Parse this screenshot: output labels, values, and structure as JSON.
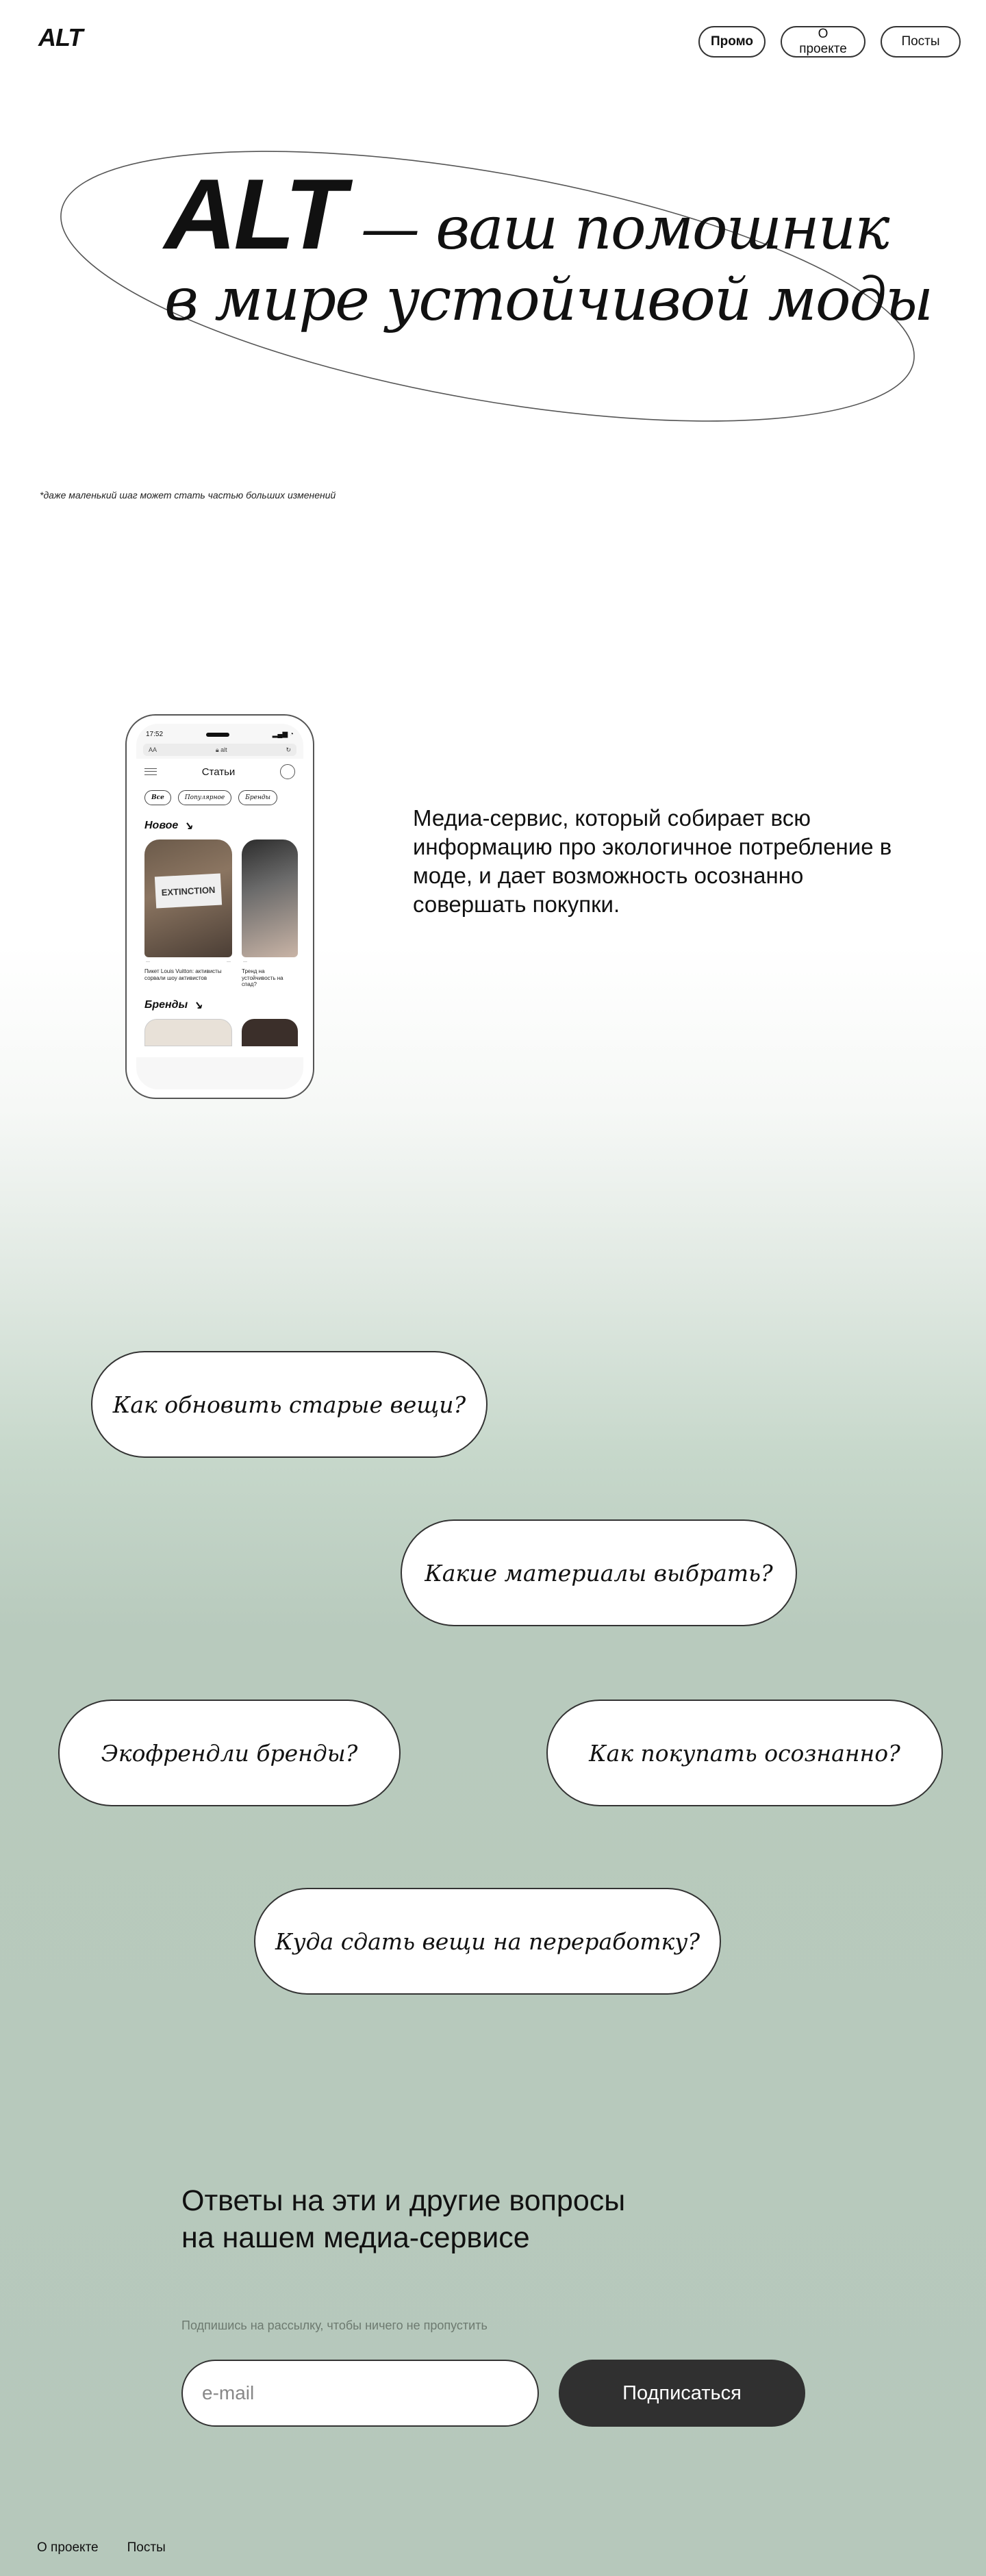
{
  "header": {
    "logo": "ALT",
    "nav": [
      {
        "label": "Промо",
        "active": true
      },
      {
        "label": "О проекте",
        "active": false
      },
      {
        "label": "Посты",
        "active": false
      }
    ]
  },
  "hero": {
    "brand": "ALT",
    "line1_rest": "— ваш помошник",
    "line2": "в мире устойчивой моды",
    "tagline": "*даже маленький шаг может стать частью больших изменений"
  },
  "phone": {
    "time": "17:52",
    "url_aa": "AA",
    "url": "alt",
    "screen_title": "Статьи",
    "chips": [
      "Все",
      "Популярное",
      "Бренды"
    ],
    "section_new": "Новое",
    "section_brands": "Бренды",
    "cards": [
      {
        "banner": "EXTINCTION",
        "caption": "Пикет Louis Vuitton: активисты сорвали шоу активистов"
      },
      {
        "banner": "",
        "caption": "Тренд на устойчивость на спад?"
      }
    ]
  },
  "description": "Медиа-сервис, который собирает всю информацию про экологичное потребление в моде, и дает возможность осознанно совершать покупки.",
  "questions": [
    "Как обновить старые вещи?",
    "Какие материалы выбрать?",
    "Экофрендли бренды?",
    "Как покупать осознанно?",
    "Куда сдать вещи на переработку?"
  ],
  "subscribe": {
    "heading_line1": "Ответы на эти и другие вопросы",
    "heading_line2": "на нашем медиа-сервисе",
    "hint": "Подпишись на рассылку, чтобы ничего не пропустить",
    "email_placeholder": "e-mail",
    "button": "Подписаться"
  },
  "footer": {
    "links": [
      "О проекте",
      "Посты"
    ]
  },
  "colors": {
    "sage": "#b6c8bb",
    "button_dark": "#303030",
    "text": "#111111"
  }
}
